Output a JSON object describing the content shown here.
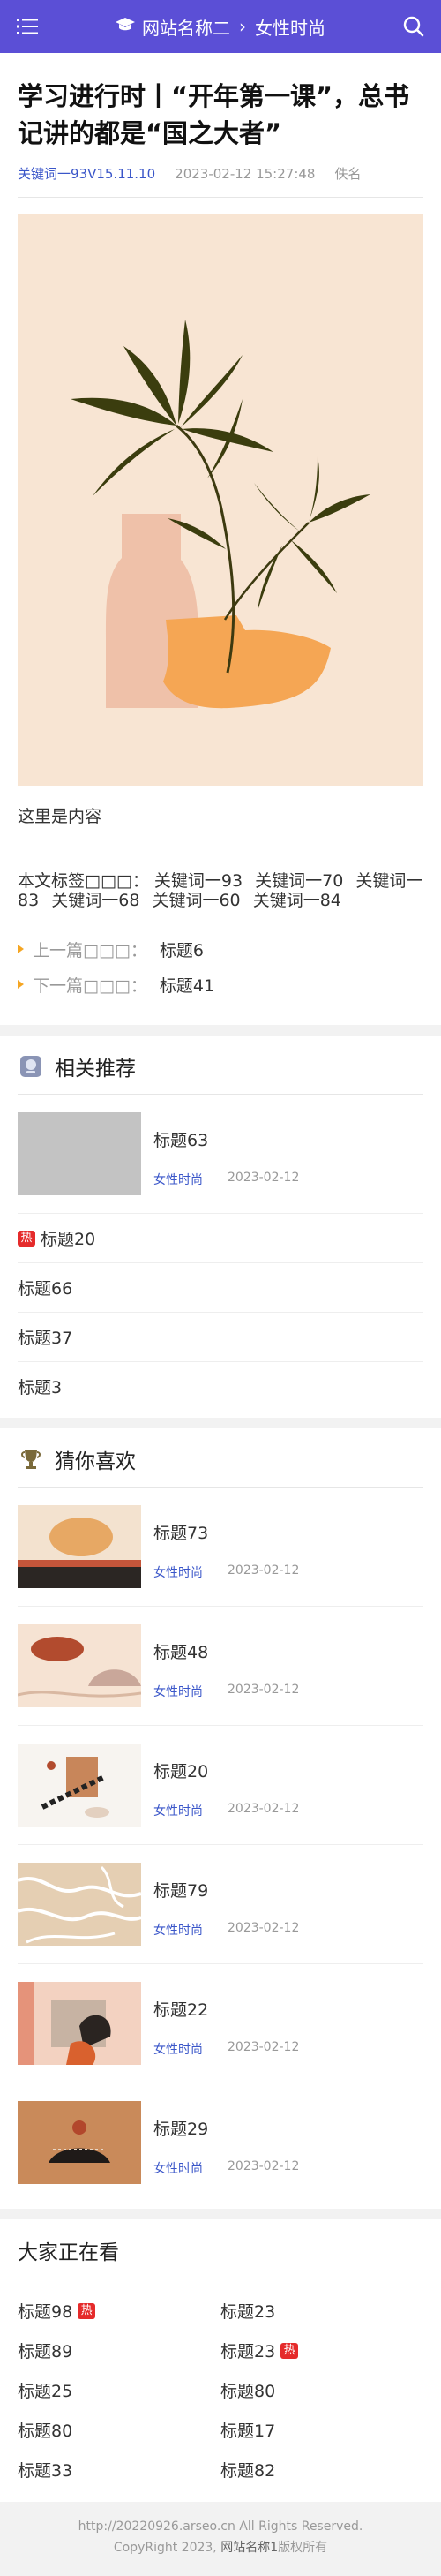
{
  "header": {
    "site_name": "网站名称二",
    "separator": "›",
    "category": "女性时尚",
    "bg_color": "#5b4fd6"
  },
  "article": {
    "title": "学习进行时丨“开年第一课”，总书记讲的都是“国之大者”",
    "keyword": "关键词一93V15.11.10",
    "datetime": "2023-02-12 15:27:48",
    "author": "佚名",
    "content": "这里是内容",
    "tags_label": "本文标签□□□：",
    "tags": [
      "关键词一93",
      "关键词一70",
      "关键词一83",
      "关键词一68",
      "关键词一60",
      "关键词一84"
    ],
    "prev_label": "上一篇□□□：",
    "prev_title": "标题6",
    "next_label": "下一篇□□□：",
    "next_title": "标题41"
  },
  "related": {
    "title": "相关推荐",
    "card": {
      "title": "标题63",
      "category": "女性时尚",
      "date": "2023-02-12"
    },
    "list": [
      {
        "title": "标题20",
        "hot": "热"
      },
      {
        "title": "标题66",
        "hot": ""
      },
      {
        "title": "标题37",
        "hot": ""
      },
      {
        "title": "标题3",
        "hot": ""
      }
    ]
  },
  "guess": {
    "title": "猜你喜欢",
    "items": [
      {
        "title": "标题73",
        "category": "女性时尚",
        "date": "2023-02-12"
      },
      {
        "title": "标题48",
        "category": "女性时尚",
        "date": "2023-02-12"
      },
      {
        "title": "标题20",
        "category": "女性时尚",
        "date": "2023-02-12"
      },
      {
        "title": "标题79",
        "category": "女性时尚",
        "date": "2023-02-12"
      },
      {
        "title": "标题22",
        "category": "女性时尚",
        "date": "2023-02-12"
      },
      {
        "title": "标题29",
        "category": "女性时尚",
        "date": "2023-02-12"
      }
    ]
  },
  "watching": {
    "title": "大家正在看",
    "items": [
      {
        "title": "标题98",
        "hot": "热"
      },
      {
        "title": "标题23",
        "hot": ""
      },
      {
        "title": "标题89",
        "hot": ""
      },
      {
        "title": "标题23",
        "hot": "热"
      },
      {
        "title": "标题25",
        "hot": ""
      },
      {
        "title": "标题80",
        "hot": ""
      },
      {
        "title": "标题80",
        "hot": ""
      },
      {
        "title": "标题17",
        "hot": ""
      },
      {
        "title": "标题33",
        "hot": ""
      },
      {
        "title": "标题82",
        "hot": ""
      }
    ]
  },
  "footer": {
    "line1": "http://20220926.arseo.cn All Rights Reserved.",
    "copyright": "CopyRight 2023,",
    "brand": "网站名称1",
    "rights": "版权所有"
  }
}
